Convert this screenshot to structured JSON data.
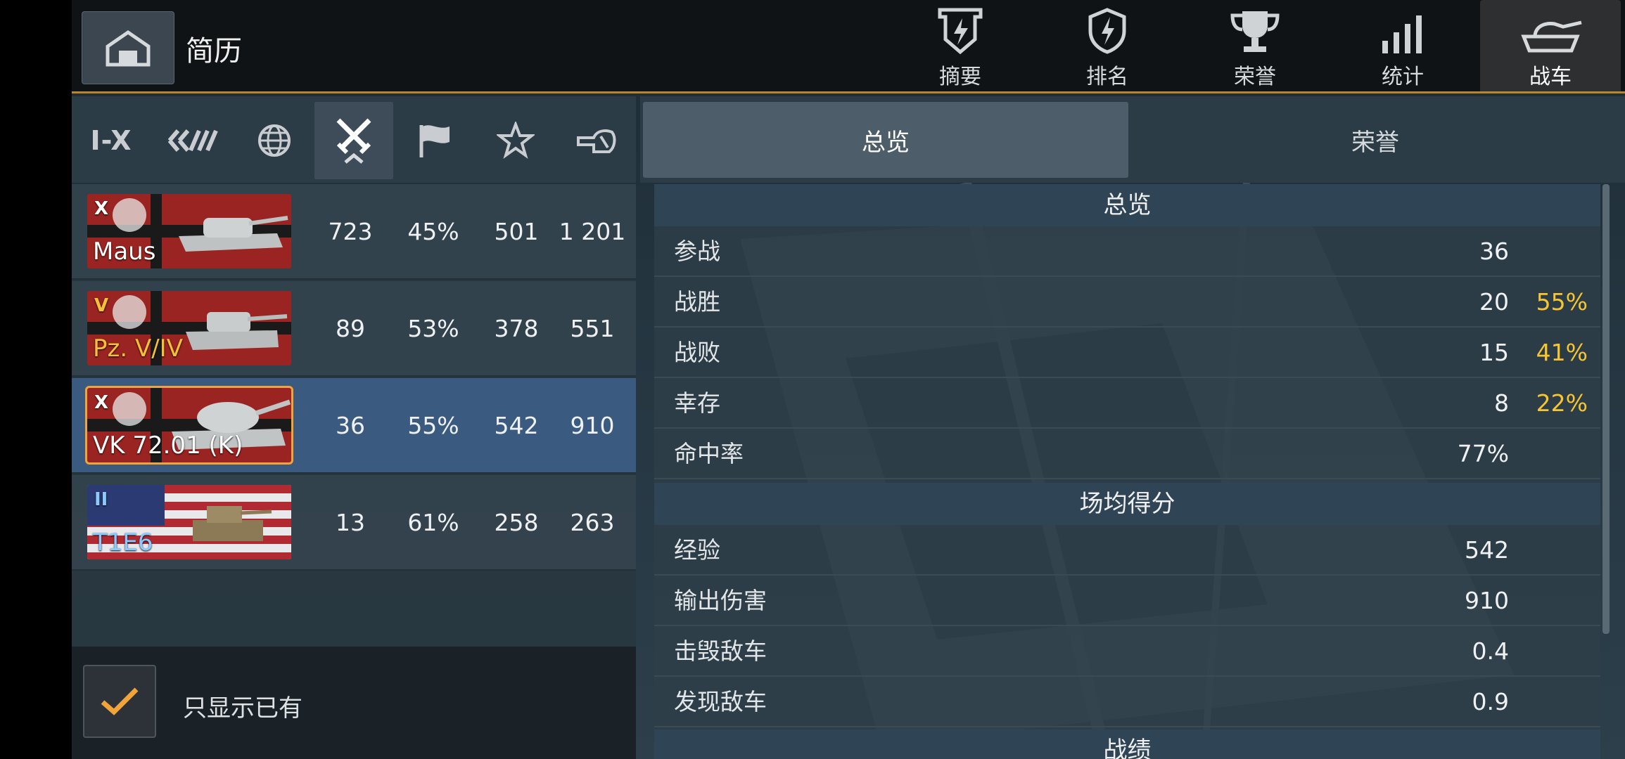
{
  "header": {
    "title": "简历",
    "tabs": [
      {
        "label": "摘要",
        "icon": "badge-lightning-icon"
      },
      {
        "label": "排名",
        "icon": "shield-lightning-icon"
      },
      {
        "label": "荣誉",
        "icon": "trophy-icon"
      },
      {
        "label": "统计",
        "icon": "bar-chart-icon"
      },
      {
        "label": "战车",
        "icon": "tank-icon",
        "active": true
      }
    ]
  },
  "filters": [
    {
      "label": "I-X",
      "icon": "tier-filter-icon"
    },
    {
      "label": "",
      "icon": "vehicle-class-icon"
    },
    {
      "label": "",
      "icon": "globe-icon"
    },
    {
      "label": "",
      "icon": "crossed-swords-icon",
      "active": true
    },
    {
      "label": "",
      "icon": "flag-icon"
    },
    {
      "label": "",
      "icon": "star-icon"
    },
    {
      "label": "",
      "icon": "tank-turret-icon"
    }
  ],
  "tanks": [
    {
      "name": "Maus",
      "tier": "X",
      "battles": "723",
      "winrate": "45%",
      "avg_xp": "501",
      "avg_dmg": "1 201",
      "flag": "germany",
      "style": "normal"
    },
    {
      "name": "Pz. V/IV",
      "tier": "V",
      "battles": "89",
      "winrate": "53%",
      "avg_xp": "378",
      "avg_dmg": "551",
      "flag": "germany",
      "style": "gold"
    },
    {
      "name": "VK 72.01 (K)",
      "tier": "X",
      "battles": "36",
      "winrate": "55%",
      "avg_xp": "542",
      "avg_dmg": "910",
      "flag": "germany",
      "style": "normal",
      "selected": true
    },
    {
      "name": "T1E6",
      "tier": "II",
      "battles": "13",
      "winrate": "61%",
      "avg_xp": "258",
      "avg_dmg": "263",
      "flag": "usa",
      "style": "blue"
    }
  ],
  "only_owned": {
    "label": "只显示已有",
    "checked": true
  },
  "right_tabs": {
    "overview": "总览",
    "honors": "荣誉"
  },
  "overview": {
    "section1": "总览",
    "rows1": [
      {
        "label": "参战",
        "value": "36",
        "pct": ""
      },
      {
        "label": "战胜",
        "value": "20",
        "pct": "55%"
      },
      {
        "label": "战败",
        "value": "15",
        "pct": "41%"
      },
      {
        "label": "幸存",
        "value": "8",
        "pct": "22%"
      },
      {
        "label": "命中率",
        "value": "77%",
        "pct": ""
      }
    ],
    "section2": "场均得分",
    "rows2": [
      {
        "label": "经验",
        "value": "542"
      },
      {
        "label": "输出伤害",
        "value": "910"
      },
      {
        "label": "击毁敌车",
        "value": "0.4"
      },
      {
        "label": "发现敌车",
        "value": "0.9"
      }
    ],
    "section3": "战绩"
  },
  "colors": {
    "accent": "#f0a43a",
    "pct": "#f6c531",
    "selected_row": "#3a5b7f"
  }
}
